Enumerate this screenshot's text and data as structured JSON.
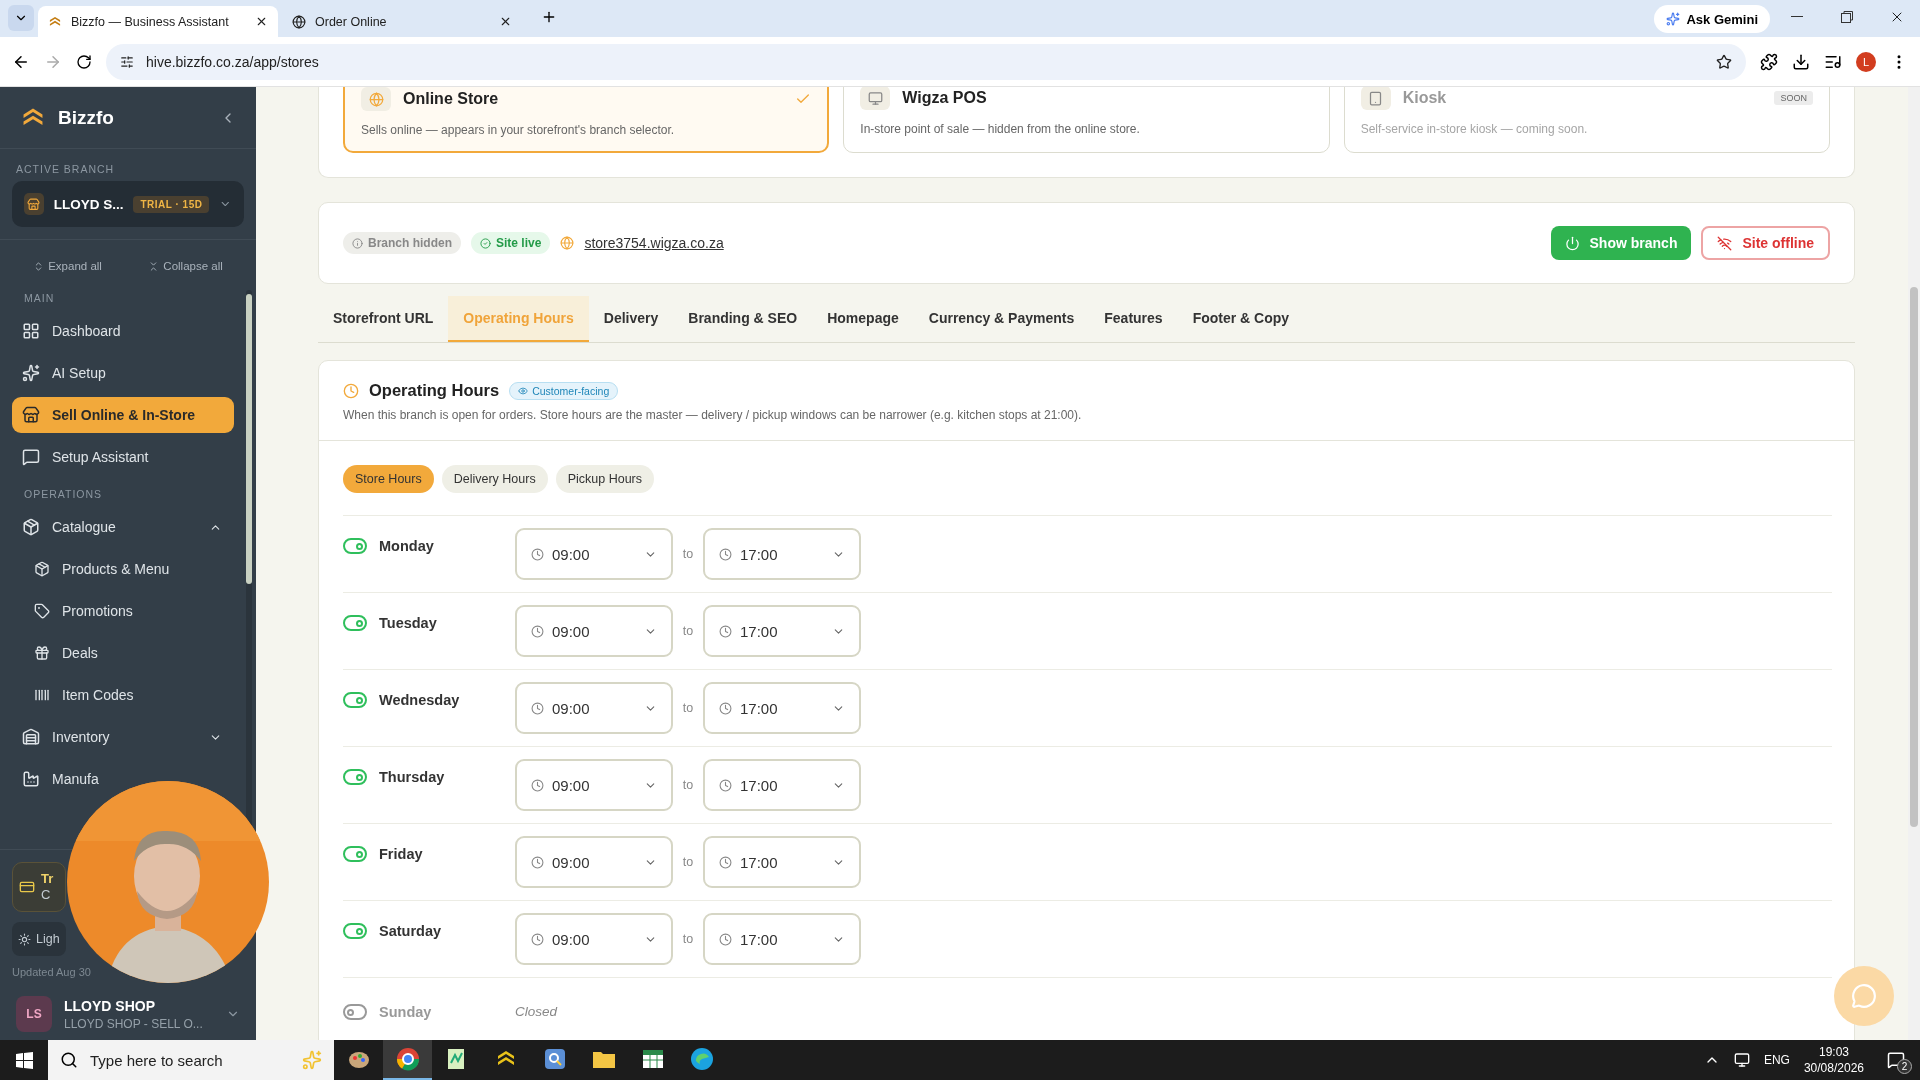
{
  "browser": {
    "tabs": [
      {
        "title": "Bizzfo — Business Assistant",
        "selected": true
      },
      {
        "title": "Order Online",
        "selected": false
      }
    ],
    "gemini": "Ask Gemini",
    "url": "hive.bizzfo.co.za/app/stores",
    "profile": "L"
  },
  "sidebar": {
    "brand": "Bizzfo",
    "branch_label": "ACTIVE BRANCH",
    "branch": {
      "name": "LLOYD S...",
      "badge": "TRIAL · 15D"
    },
    "expand_all": "Expand all",
    "collapse_all": "Collapse all",
    "sections": [
      {
        "title": "MAIN",
        "items": [
          {
            "label": "Dashboard",
            "selected": false
          },
          {
            "label": "AI Setup",
            "selected": false
          },
          {
            "label": "Sell Online & In-Store",
            "selected": true
          },
          {
            "label": "Setup Assistant",
            "selected": false
          }
        ]
      },
      {
        "title": "OPERATIONS",
        "items": [
          {
            "label": "Catalogue",
            "selected": false,
            "expanded": true,
            "children": [
              {
                "label": "Products & Menu",
                "selected": false
              },
              {
                "label": "Promotions",
                "selected": false
              },
              {
                "label": "Deals",
                "selected": false
              },
              {
                "label": "Item Codes",
                "selected": false
              }
            ]
          },
          {
            "label": "Inventory",
            "selected": false,
            "expanded": false
          },
          {
            "label": "Manufa",
            "selected": false
          }
        ]
      }
    ],
    "trial_card": {
      "title": "Tr",
      "subtitle": "C"
    },
    "theme_button": "Ligh",
    "updated": "Updated Aug 30",
    "user": {
      "initials": "LS",
      "name": "LLOYD SHOP",
      "subtitle": "LLOYD SHOP - SELL O..."
    }
  },
  "channels": [
    {
      "name": "Online Store",
      "description": "Sells online — appears in your storefront's branch selector.",
      "selected": true,
      "disabled": false
    },
    {
      "name": "Wigza POS",
      "description": "In-store point of sale — hidden from the online store.",
      "selected": false,
      "disabled": false
    },
    {
      "name": "Kiosk",
      "description": "Self-service in-store kiosk — coming soon.",
      "selected": false,
      "disabled": true,
      "badge": "SOON"
    }
  ],
  "status_bar": {
    "chips": [
      {
        "label": "Branch hidden",
        "kind": "neutral"
      },
      {
        "label": "Site live",
        "kind": "success"
      }
    ],
    "link": "store3754.wigza.co.za",
    "buttons": [
      {
        "label": "Show branch",
        "kind": "primary"
      },
      {
        "label": "Site offline",
        "kind": "danger"
      }
    ]
  },
  "tabs": [
    {
      "label": "Storefront URL",
      "selected": false
    },
    {
      "label": "Operating Hours",
      "selected": true
    },
    {
      "label": "Delivery",
      "selected": false
    },
    {
      "label": "Branding & SEO",
      "selected": false
    },
    {
      "label": "Homepage",
      "selected": false
    },
    {
      "label": "Currency & Payments",
      "selected": false
    },
    {
      "label": "Features",
      "selected": false
    },
    {
      "label": "Footer & Copy",
      "selected": false
    }
  ],
  "hours": {
    "title": "Operating Hours",
    "badge": "Customer-facing",
    "description": "When this branch is open for orders. Store hours are the master — delivery / pickup windows can be narrower (e.g. kitchen stops at 21:00).",
    "subtabs": [
      {
        "label": "Store Hours",
        "selected": true
      },
      {
        "label": "Delivery Hours",
        "selected": false
      },
      {
        "label": "Pickup Hours",
        "selected": false
      }
    ],
    "days": [
      {
        "day": "Monday",
        "open": true,
        "from": "09:00",
        "separator": "to",
        "to": "17:00"
      },
      {
        "day": "Tuesday",
        "open": true,
        "from": "09:00",
        "separator": "to",
        "to": "17:00"
      },
      {
        "day": "Wednesday",
        "open": true,
        "from": "09:00",
        "separator": "to",
        "to": "17:00"
      },
      {
        "day": "Thursday",
        "open": true,
        "from": "09:00",
        "separator": "to",
        "to": "17:00"
      },
      {
        "day": "Friday",
        "open": true,
        "from": "09:00",
        "separator": "to",
        "to": "17:00"
      },
      {
        "day": "Saturday",
        "open": true,
        "from": "09:00",
        "separator": "to",
        "to": "17:00"
      },
      {
        "day": "Sunday",
        "open": false,
        "closed_label": "Closed"
      }
    ]
  },
  "taskbar": {
    "search_placeholder": "Type here to search",
    "apps": [
      {
        "kind": "paint",
        "selected": false
      },
      {
        "kind": "chrome",
        "selected": true
      },
      {
        "kind": "notepad",
        "selected": false
      },
      {
        "kind": "chevron",
        "selected": false
      },
      {
        "kind": "finder",
        "selected": false
      },
      {
        "kind": "folder",
        "selected": false
      },
      {
        "kind": "sheet",
        "selected": false
      },
      {
        "kind": "edge",
        "selected": false
      }
    ],
    "language": "ENG",
    "time": "19:03",
    "date": "30/08/2026",
    "notifications": "2"
  }
}
